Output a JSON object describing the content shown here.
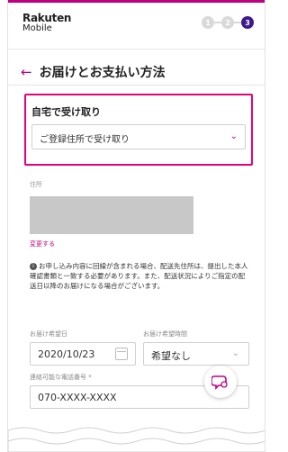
{
  "brand": {
    "line1": "Rakuten",
    "line2": "Mobile"
  },
  "steps": [
    "1",
    "2",
    "3"
  ],
  "page": {
    "title": "お届けとお支払い方法",
    "back_icon": "back-arrow-icon"
  },
  "delivery_card": {
    "title": "自宅で受け取り",
    "select_value": "ご登録住所で受け取り"
  },
  "address": {
    "label": "住所",
    "change_link": "変更する"
  },
  "notice": {
    "text": "お申し込み内容に回線が含まれる場合、配送先住所は、提出した本人確認書類と一致する必要があります。また、配送状況によりご指定の配送日以降のお届けになる場合がございます。"
  },
  "delivery_date": {
    "label": "お届け希望日",
    "value": "2020/10/23"
  },
  "delivery_time": {
    "label": "お届け希望時間",
    "value": "希望なし"
  },
  "phone": {
    "label": "連絡可能な電話番号 *",
    "value": "070-XXXX-XXXX"
  },
  "colors": {
    "accent": "#bf0080",
    "highlight_border": "#e8007a",
    "step_active": "#3d1a8c"
  }
}
